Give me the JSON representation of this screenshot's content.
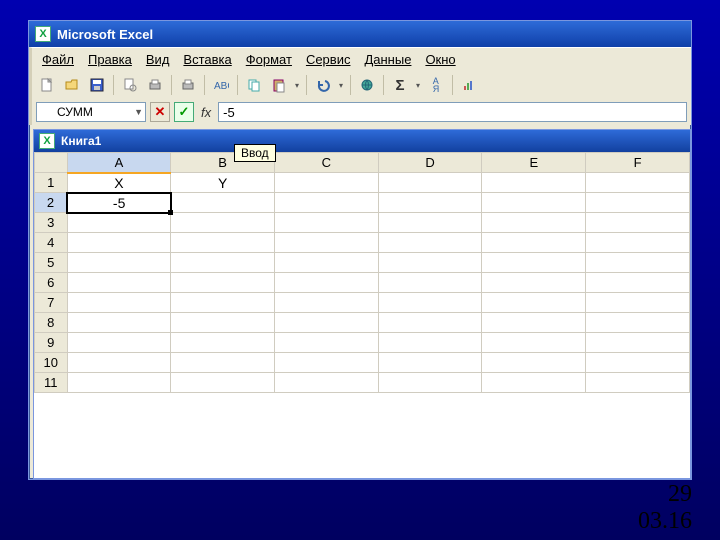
{
  "app": {
    "title": "Microsoft Excel"
  },
  "menu": {
    "file": "Файл",
    "edit": "Правка",
    "view": "Вид",
    "insert": "Вставка",
    "format": "Формат",
    "service": "Сервис",
    "data": "Данные",
    "window": "Окно"
  },
  "toolbar": {
    "sigma": "Σ",
    "sort": "А↓Я"
  },
  "formulabar": {
    "name_box": "СУММ",
    "fx_label": "fx",
    "value": "-5",
    "tooltip": "Ввод"
  },
  "workbook": {
    "title": "Книга1"
  },
  "columns": [
    "A",
    "B",
    "C",
    "D",
    "E",
    "F"
  ],
  "rows": [
    "1",
    "2",
    "3",
    "4",
    "5",
    "6",
    "7",
    "8",
    "9",
    "10",
    "11"
  ],
  "cells": {
    "A1": "X",
    "B1": "Y",
    "A2": "-5"
  },
  "active": {
    "col": "A",
    "row": "2"
  },
  "footer": {
    "page": "29",
    "date": "03.16"
  }
}
